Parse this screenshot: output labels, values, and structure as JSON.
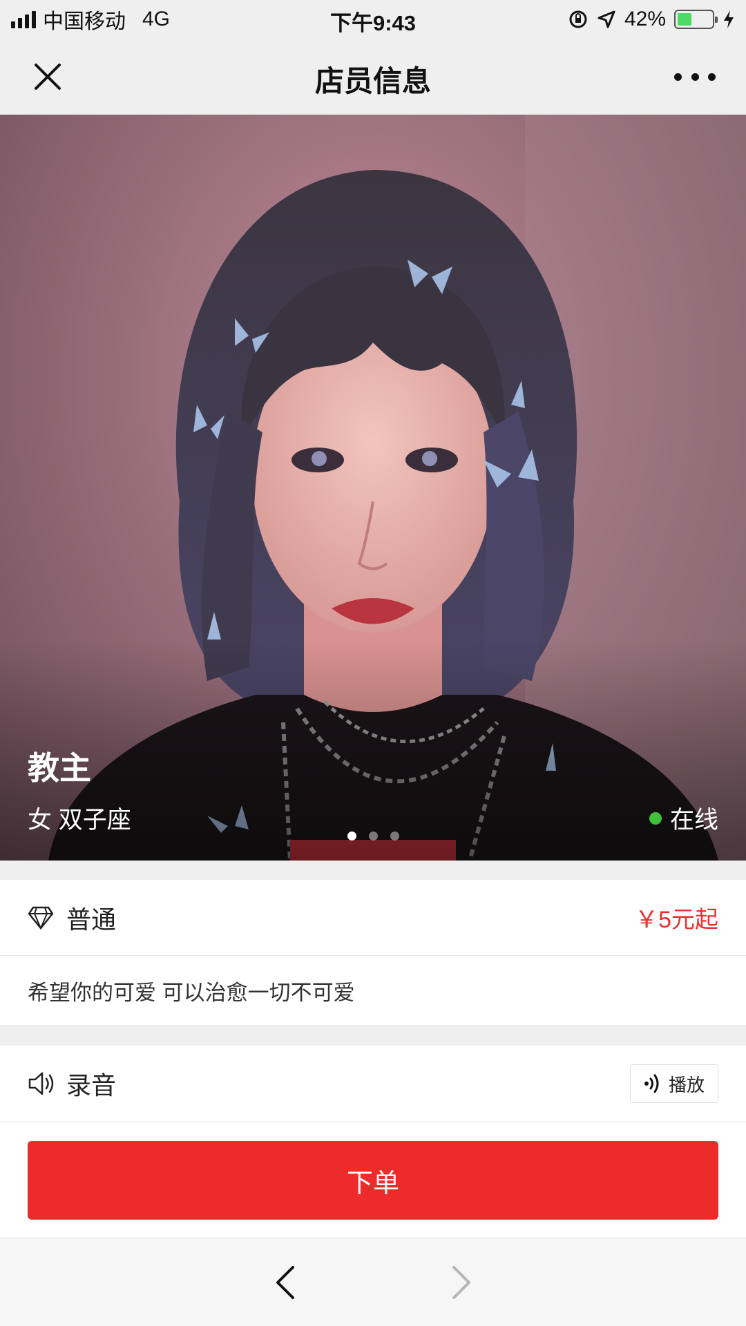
{
  "status_bar": {
    "carrier": "中国移动",
    "network": "4G",
    "time": "下午9:43",
    "battery_percent": "42%",
    "battery_level": 0.42
  },
  "nav": {
    "title": "店员信息"
  },
  "profile": {
    "name": "教主",
    "meta": "女 双子座",
    "status": "在线",
    "photo_count": 3,
    "active_photo": 1
  },
  "level": {
    "label": "普通",
    "price": "￥5元起"
  },
  "description": "希望你的可爱 可以治愈一切不可爱",
  "audio": {
    "label": "录音",
    "play_label": "播放"
  },
  "order_button": "下单",
  "colors": {
    "accent_red": "#ee2b2b",
    "price_red": "#e8322f",
    "online_green": "#3fc23a"
  }
}
